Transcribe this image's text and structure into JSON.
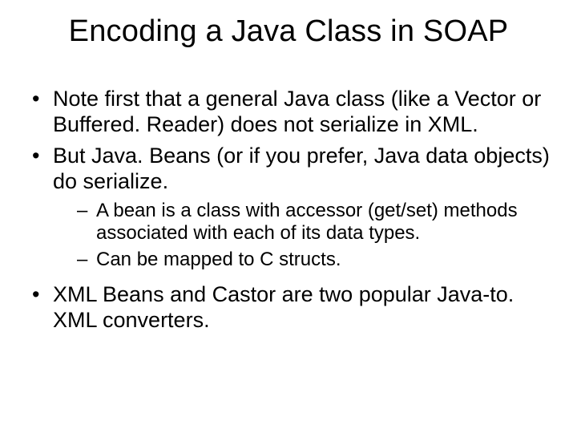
{
  "title": "Encoding a Java Class in SOAP",
  "bullets": [
    {
      "text": "Note first that a general Java class (like a Vector or Buffered. Reader) does not serialize in XML."
    },
    {
      "text": "But Java. Beans (or if you prefer, Java data objects) do serialize.",
      "sub": [
        {
          "text": "A bean is a class with accessor (get/set) methods associated with each of its data types."
        },
        {
          "text": "Can be mapped to C structs."
        }
      ]
    },
    {
      "text": "XML Beans and Castor are two popular Java-to. XML converters."
    }
  ]
}
